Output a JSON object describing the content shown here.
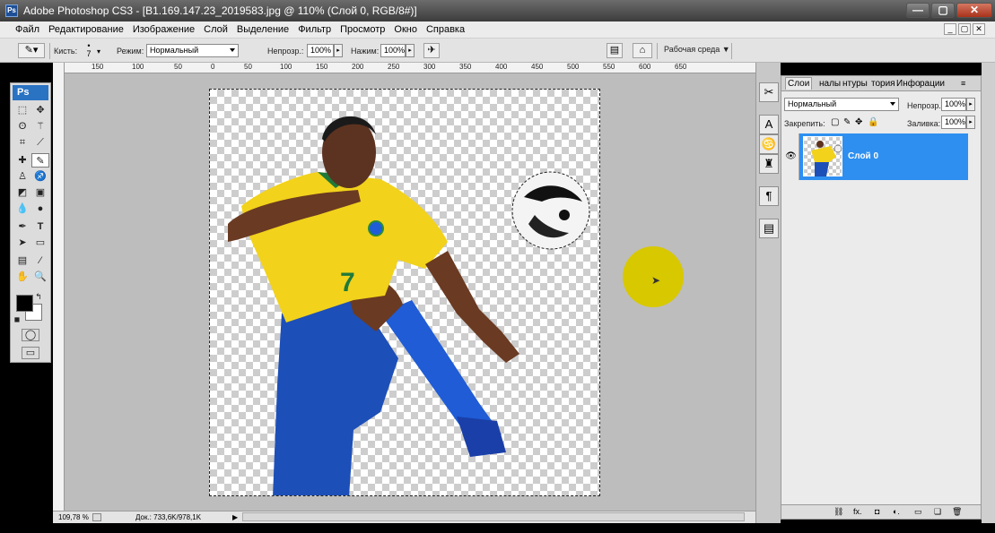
{
  "window": {
    "title": "Adobe Photoshop CS3 - [B1.169.147.23_2019583.jpg @ 110% (Слой 0, RGB/8#)]",
    "logo": "Ps",
    "min": "—",
    "max": "▢",
    "close": "✕"
  },
  "menu": [
    "Файл",
    "Редактирование",
    "Изображение",
    "Слой",
    "Выделение",
    "Фильтр",
    "Просмотр",
    "Окно",
    "Справка"
  ],
  "mdi_buttons": [
    "_",
    "▢",
    "✕"
  ],
  "options": {
    "brush_label": "Кисть:",
    "brush_size": "7",
    "mode_label": "Режим:",
    "mode_value": "Нормальный",
    "opacity_label": "Непрозр.:",
    "opacity_value": "100%",
    "flow_label": "Нажим:",
    "flow_value": "100%",
    "workspace_label": "Рабочая среда ▼"
  },
  "toolbox": {
    "logo": "Ps"
  },
  "ruler_ticks": [
    "150",
    "100",
    "50",
    "0",
    "50",
    "100",
    "150",
    "200",
    "250",
    "300",
    "350",
    "400",
    "450",
    "500",
    "550",
    "600",
    "650"
  ],
  "status": {
    "zoom": "109,78 %",
    "doc": "Док.: 733,6K/978,1K"
  },
  "layers_panel": {
    "tabs": [
      "Слои",
      "налы",
      "нтуры",
      "тория",
      "Инфо",
      "рации"
    ],
    "blend_mode": "Нормальный",
    "opacity_label": "Непрозр.:",
    "opacity_value": "100%",
    "lock_label": "Закрепить:",
    "fill_label": "Заливка:",
    "fill_value": "100%",
    "layer_name": "Слой 0",
    "footer_icons": [
      "⛓",
      "fx.",
      "◘",
      "◐.",
      "▭",
      "❏",
      "🗑"
    ]
  },
  "colors": {
    "accent": "#2e8ff0",
    "cursor_highlight": "#d8c800"
  }
}
